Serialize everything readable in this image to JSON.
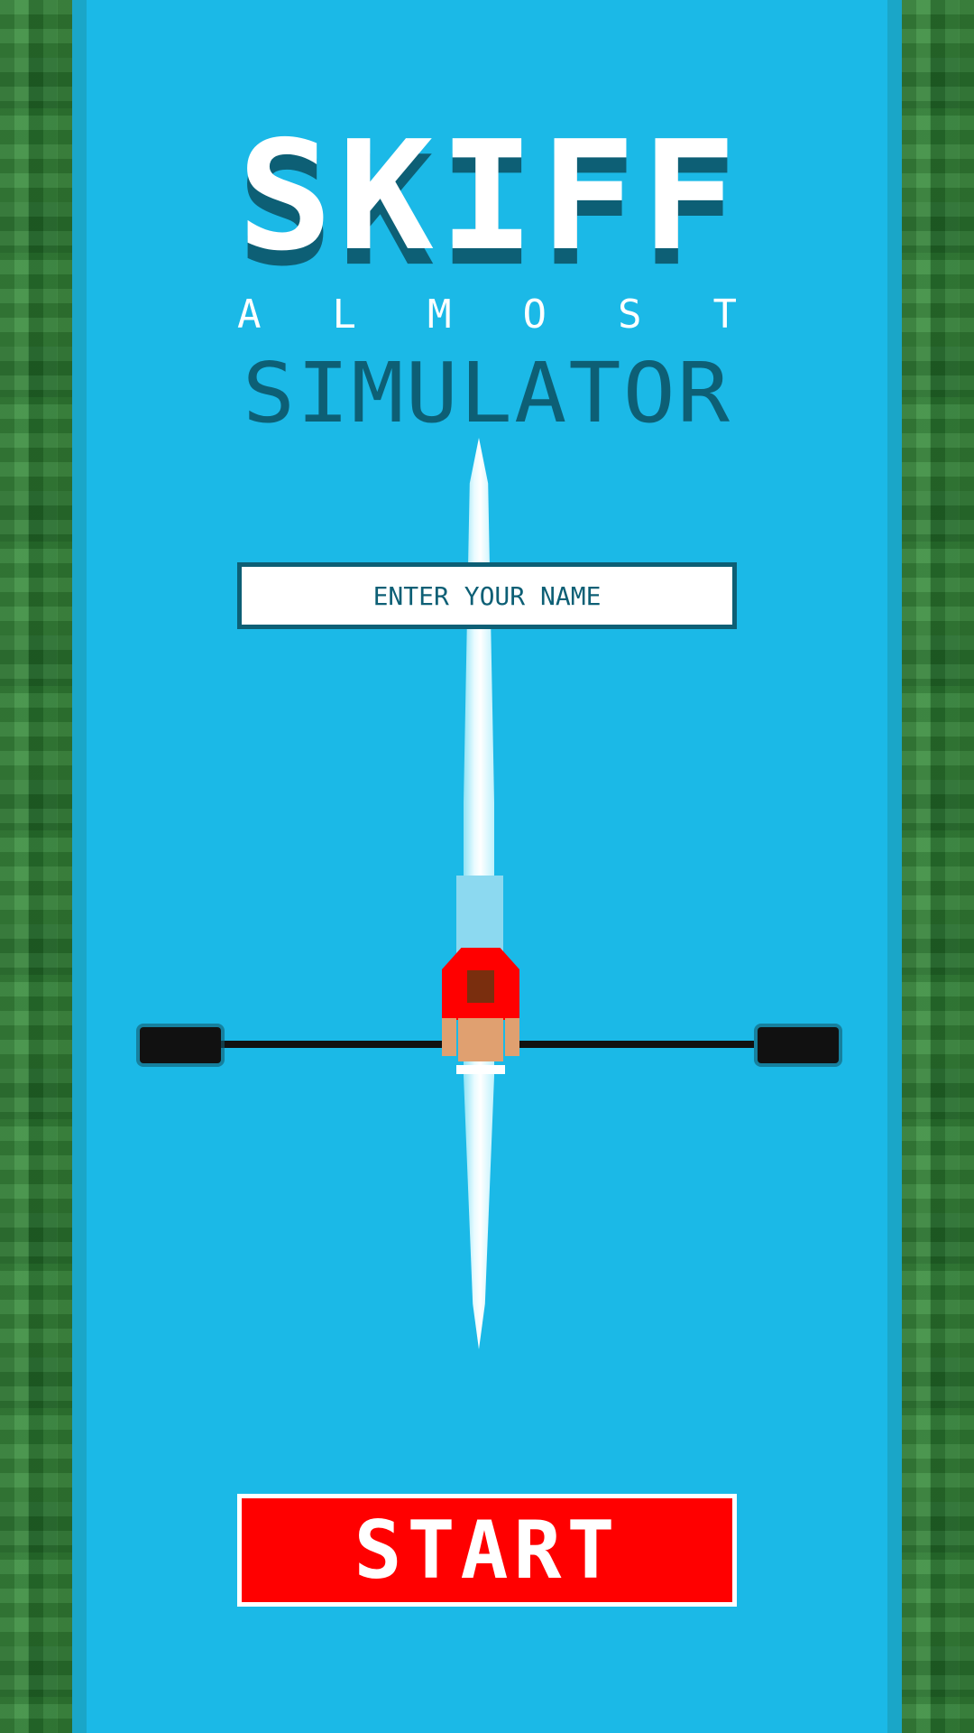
{
  "title": {
    "main": "SKIFF",
    "almost_letters": [
      "A",
      "L",
      "M",
      "O",
      "S",
      "T"
    ],
    "sub": "SIMULATOR"
  },
  "name_input": {
    "placeholder": "ENTER YOUR NAME",
    "value": ""
  },
  "start_button": {
    "label": "START"
  },
  "colors": {
    "water": "#1bb9e7",
    "grass": "#2e7d32",
    "title_dark": "#0d5f75",
    "start_red": "#ff0000",
    "rower_shirt": "#ff0000"
  }
}
